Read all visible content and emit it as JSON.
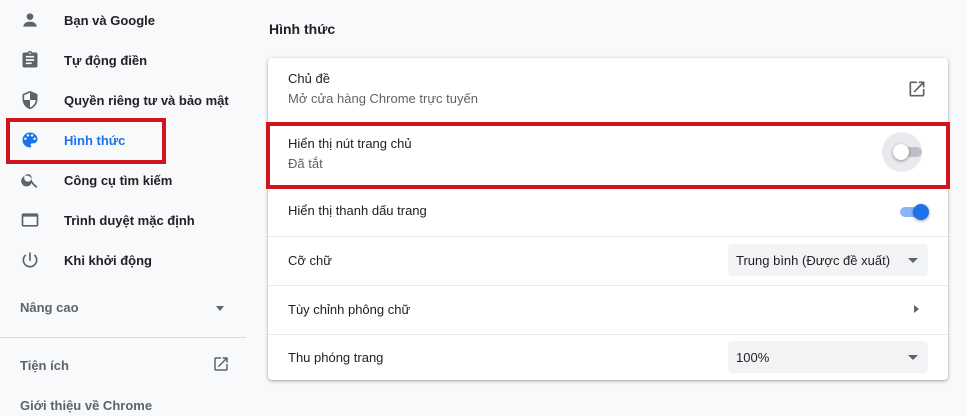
{
  "sidebar": {
    "items": [
      {
        "label": "Bạn và Google",
        "icon": "person-icon"
      },
      {
        "label": "Tự động điền",
        "icon": "clipboard-icon"
      },
      {
        "label": "Quyền riêng tư và bảo mật",
        "icon": "shield-icon"
      },
      {
        "label": "Hình thức",
        "icon": "palette-icon",
        "active": true
      },
      {
        "label": "Công cụ tìm kiếm",
        "icon": "search-icon"
      },
      {
        "label": "Trình duyệt mặc định",
        "icon": "browser-window-icon"
      },
      {
        "label": "Khi khởi động",
        "icon": "power-icon"
      }
    ],
    "advanced_label": "Nâng cao",
    "extensions_label": "Tiện ích",
    "about_label": "Giới thiệu về Chrome"
  },
  "main": {
    "section_title": "Hình thức",
    "theme": {
      "title": "Chủ đề",
      "subtitle": "Mở cửa hàng Chrome trực tuyến"
    },
    "home_button": {
      "title": "Hiển thị nút trang chủ",
      "subtitle": "Đã tắt",
      "enabled": false
    },
    "bookmarks_bar": {
      "title": "Hiển thị thanh dấu trang",
      "enabled": true
    },
    "font_size": {
      "title": "Cỡ chữ",
      "value": "Trung bình (Được đề xuất)"
    },
    "customize_fonts": {
      "title": "Tùy chỉnh phông chữ"
    },
    "page_zoom": {
      "title": "Thu phóng trang",
      "value": "100%"
    }
  },
  "colors": {
    "accent": "#1a73e8",
    "highlight_box": "#d0151f"
  }
}
